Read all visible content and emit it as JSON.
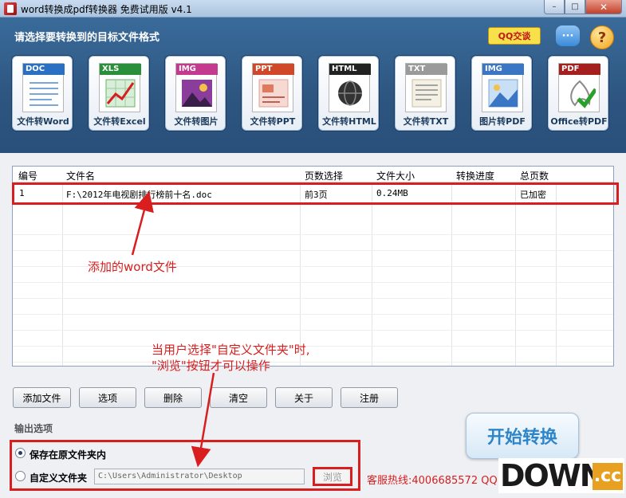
{
  "window": {
    "title": "word转换成pdf转换器 免费试用版 v4.1",
    "min": "–",
    "max": "□",
    "close": "✕"
  },
  "header": {
    "heading": "请选择要转换到的目标文件格式",
    "qq_label": "QQ交谈",
    "chat_label": "···",
    "help_label": "?"
  },
  "formats": [
    {
      "tag": "DOC",
      "label": "文件转Word",
      "tag_color": "#2b6fc2",
      "icon": "word-doc-icon"
    },
    {
      "tag": "XLS",
      "label": "文件转Excel",
      "tag_color": "#2a8f3b",
      "icon": "excel-chart-icon"
    },
    {
      "tag": "IMG",
      "label": "文件转图片",
      "tag_color": "#c43a8e",
      "icon": "image-icon"
    },
    {
      "tag": "PPT",
      "label": "文件转PPT",
      "tag_color": "#d0472a",
      "icon": "ppt-icon"
    },
    {
      "tag": "HTML",
      "label": "文件转HTML",
      "tag_color": "#222222",
      "icon": "html-globe-icon"
    },
    {
      "tag": "TXT",
      "label": "文件转TXT",
      "tag_color": "#9a9a9a",
      "icon": "txt-doc-icon"
    },
    {
      "tag": "IMG",
      "label": "图片转PDF",
      "tag_color": "#3b76c4",
      "icon": "picture-icon"
    },
    {
      "tag": "PDF",
      "label": "Office转PDF",
      "tag_color": "#a51f1f",
      "icon": "pdf-check-icon"
    }
  ],
  "table": {
    "headers": [
      "编号",
      "文件名",
      "页数选择",
      "文件大小",
      "转换进度",
      "总页数"
    ],
    "rows": [
      [
        "1",
        "F:\\2012年电视剧排行榜前十名.doc",
        "前3页",
        "0.24MB",
        "",
        "已加密"
      ]
    ]
  },
  "annotations": {
    "added_file": "添加的word文件",
    "browse_note_line1": "当用户选择\"自定义文件夹\"时,",
    "browse_note_line2": "\"浏览\"按钮才可以操作"
  },
  "buttons": [
    "添加文件",
    "选项",
    "删除",
    "清空",
    "关于",
    "注册"
  ],
  "output": {
    "label": "输出选项",
    "option_original": "保存在原文件夹内",
    "option_custom": "自定义文件夹",
    "selected": "保存在原文件夹内",
    "path_value": "C:\\Users\\Administrator\\Desktop",
    "browse_label": "浏览"
  },
  "start_label": "开始转换",
  "hotline": "客服热线:4006685572 QQ",
  "watermark": {
    "main": "DOWN",
    "suffix": ".cc"
  },
  "colors": {
    "accent_red": "#d81e1e",
    "header_blue": "#2d5580",
    "start_text": "#2e86c9"
  }
}
